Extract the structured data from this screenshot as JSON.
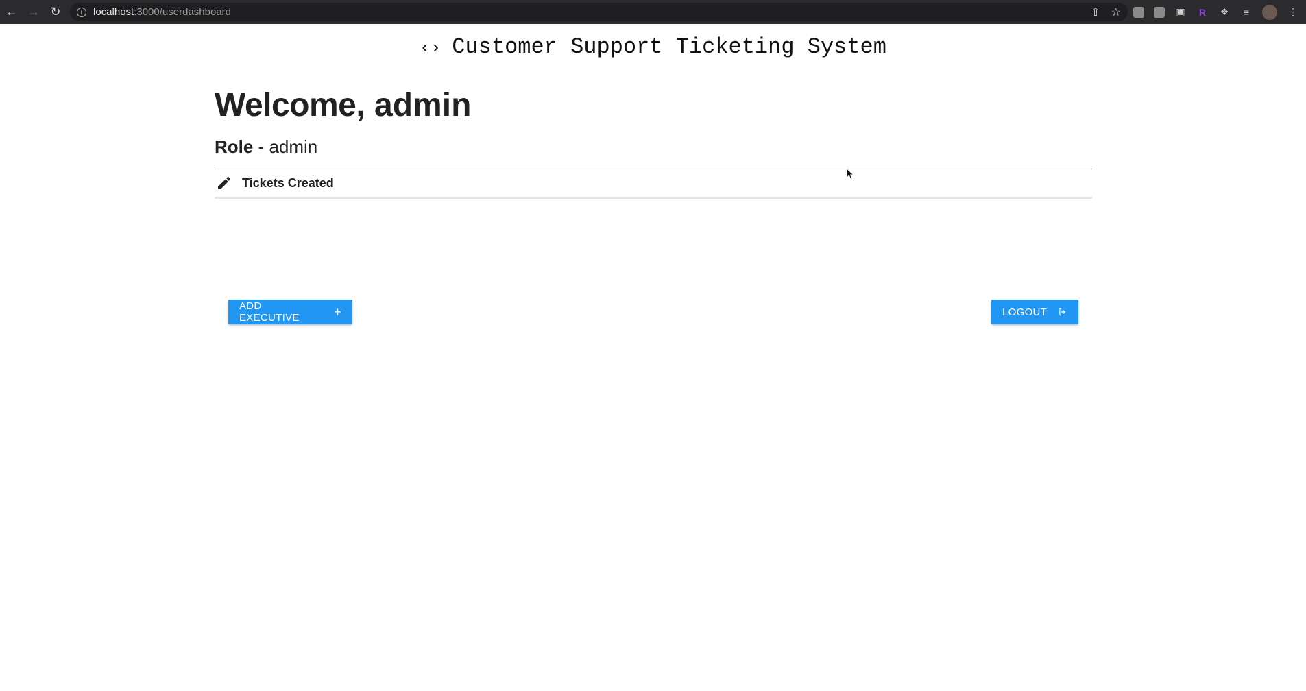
{
  "browser": {
    "url_host": "localhost",
    "url_path": ":3000/userdashboard",
    "back_icon": "back-arrow-icon",
    "forward_icon": "forward-arrow-icon",
    "reload_icon": "reload-icon"
  },
  "header": {
    "title": "Customer Support Ticketing System",
    "code_icon": "‹›"
  },
  "welcome": {
    "greeting": "Welcome",
    "username": ", admin"
  },
  "role": {
    "label": "Role",
    "value": " - admin"
  },
  "section": {
    "tickets_label": "Tickets Created"
  },
  "buttons": {
    "add_executive": "ADD EXECUTIVE",
    "logout": "LOGOUT"
  },
  "colors": {
    "primary": "#2196f3",
    "chrome": "#2b2b2d"
  }
}
